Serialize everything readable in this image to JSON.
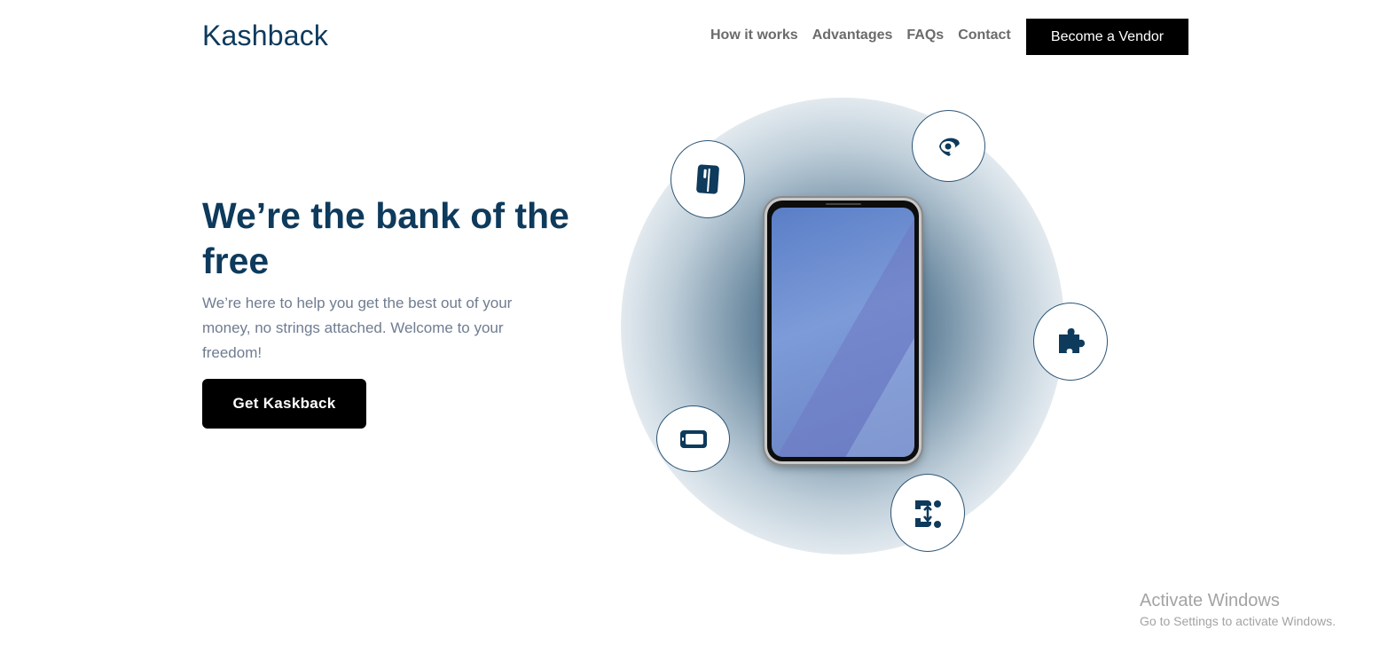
{
  "header": {
    "logo": "Kashback",
    "nav": [
      {
        "label": "How it works"
      },
      {
        "label": "Advantages"
      },
      {
        "label": "FAQs"
      },
      {
        "label": "Contact"
      }
    ],
    "vendor_button": "Become a Vendor"
  },
  "hero": {
    "title": "We’re the bank of the free",
    "subtitle": "We’re here to help you get the best out of your money, no strings attached. Welcome to your freedom!",
    "cta": "Get Kaskback"
  },
  "illustration": {
    "feature_icons": [
      "card-icon",
      "eye-tag-icon",
      "puzzle-icon",
      "tablet-icon",
      "exchange-icon"
    ]
  },
  "watermark": {
    "title": "Activate Windows",
    "subtitle": "Go to Settings to activate Windows."
  },
  "colors": {
    "brand": "#0e3a5c",
    "text_muted": "#6f7c90",
    "button_bg": "#000000"
  }
}
